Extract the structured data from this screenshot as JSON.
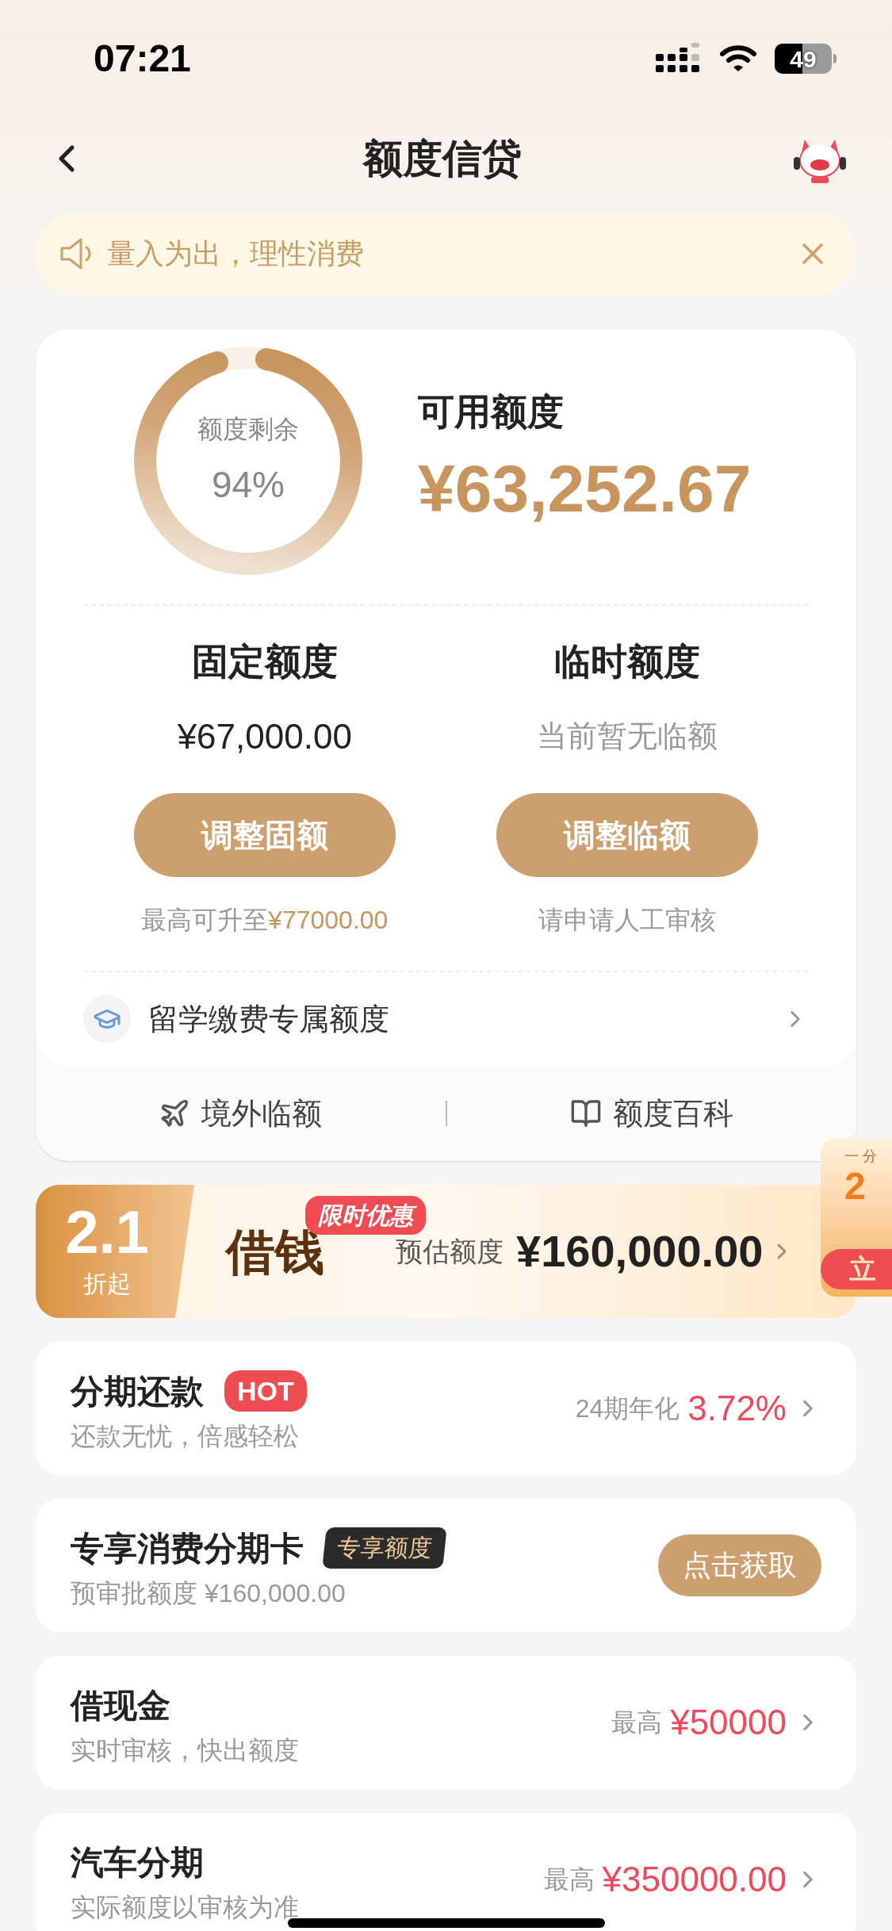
{
  "status_bar": {
    "time": "07:21",
    "battery": "49"
  },
  "nav": {
    "title": "额度信贷"
  },
  "notice": {
    "text": "量入为出，理性消费"
  },
  "credit": {
    "ring_label": "额度剩余",
    "ring_value": "94%",
    "level": 0.94,
    "available_label": "可用额度",
    "available_amount": "¥63,252.67",
    "columns": [
      {
        "title": "固定额度",
        "value": "¥67,000.00",
        "kind": "amount",
        "button": "调整固额",
        "note": "最高可升至",
        "note_highlight": "¥77000.00"
      },
      {
        "title": "临时额度",
        "value": "当前暂无临额",
        "kind": "empty",
        "button": "调整临额",
        "note": "请申请人工审核"
      }
    ],
    "study": {
      "text": "留学缴费专属额度"
    },
    "links": [
      {
        "label": "境外临额",
        "kind": "plane"
      },
      {
        "label": "额度百科",
        "kind": "book"
      }
    ]
  },
  "promo": {
    "discount": "2.1",
    "discount_note": "折起",
    "title": "借钱",
    "tag": "限时优惠",
    "amount_label": "预估额度",
    "amount": "¥160,000.00"
  },
  "float_ad": {
    "tag": "一 分",
    "number": "2",
    "button": "立"
  },
  "products": [
    {
      "title": "分期还款",
      "badge": "HOT",
      "subtitle": "还款无忧，倍感轻松",
      "kind": "rate",
      "right_label": "24期年化",
      "right_value": "3.72%"
    },
    {
      "title": "专享消费分期卡",
      "badge": "专享额度",
      "subtitle": "预审批额度 ¥160,000.00",
      "kind": "button",
      "button": "点击获取"
    },
    {
      "title": "借现金",
      "subtitle": "实时审核，快出额度",
      "kind": "rate",
      "right_label": "最高",
      "right_value": "¥50000"
    },
    {
      "title": "汽车分期",
      "subtitle": "实际额度以审核为准",
      "kind": "rate",
      "right_label": "最高",
      "right_value": "¥350000.00"
    }
  ]
}
